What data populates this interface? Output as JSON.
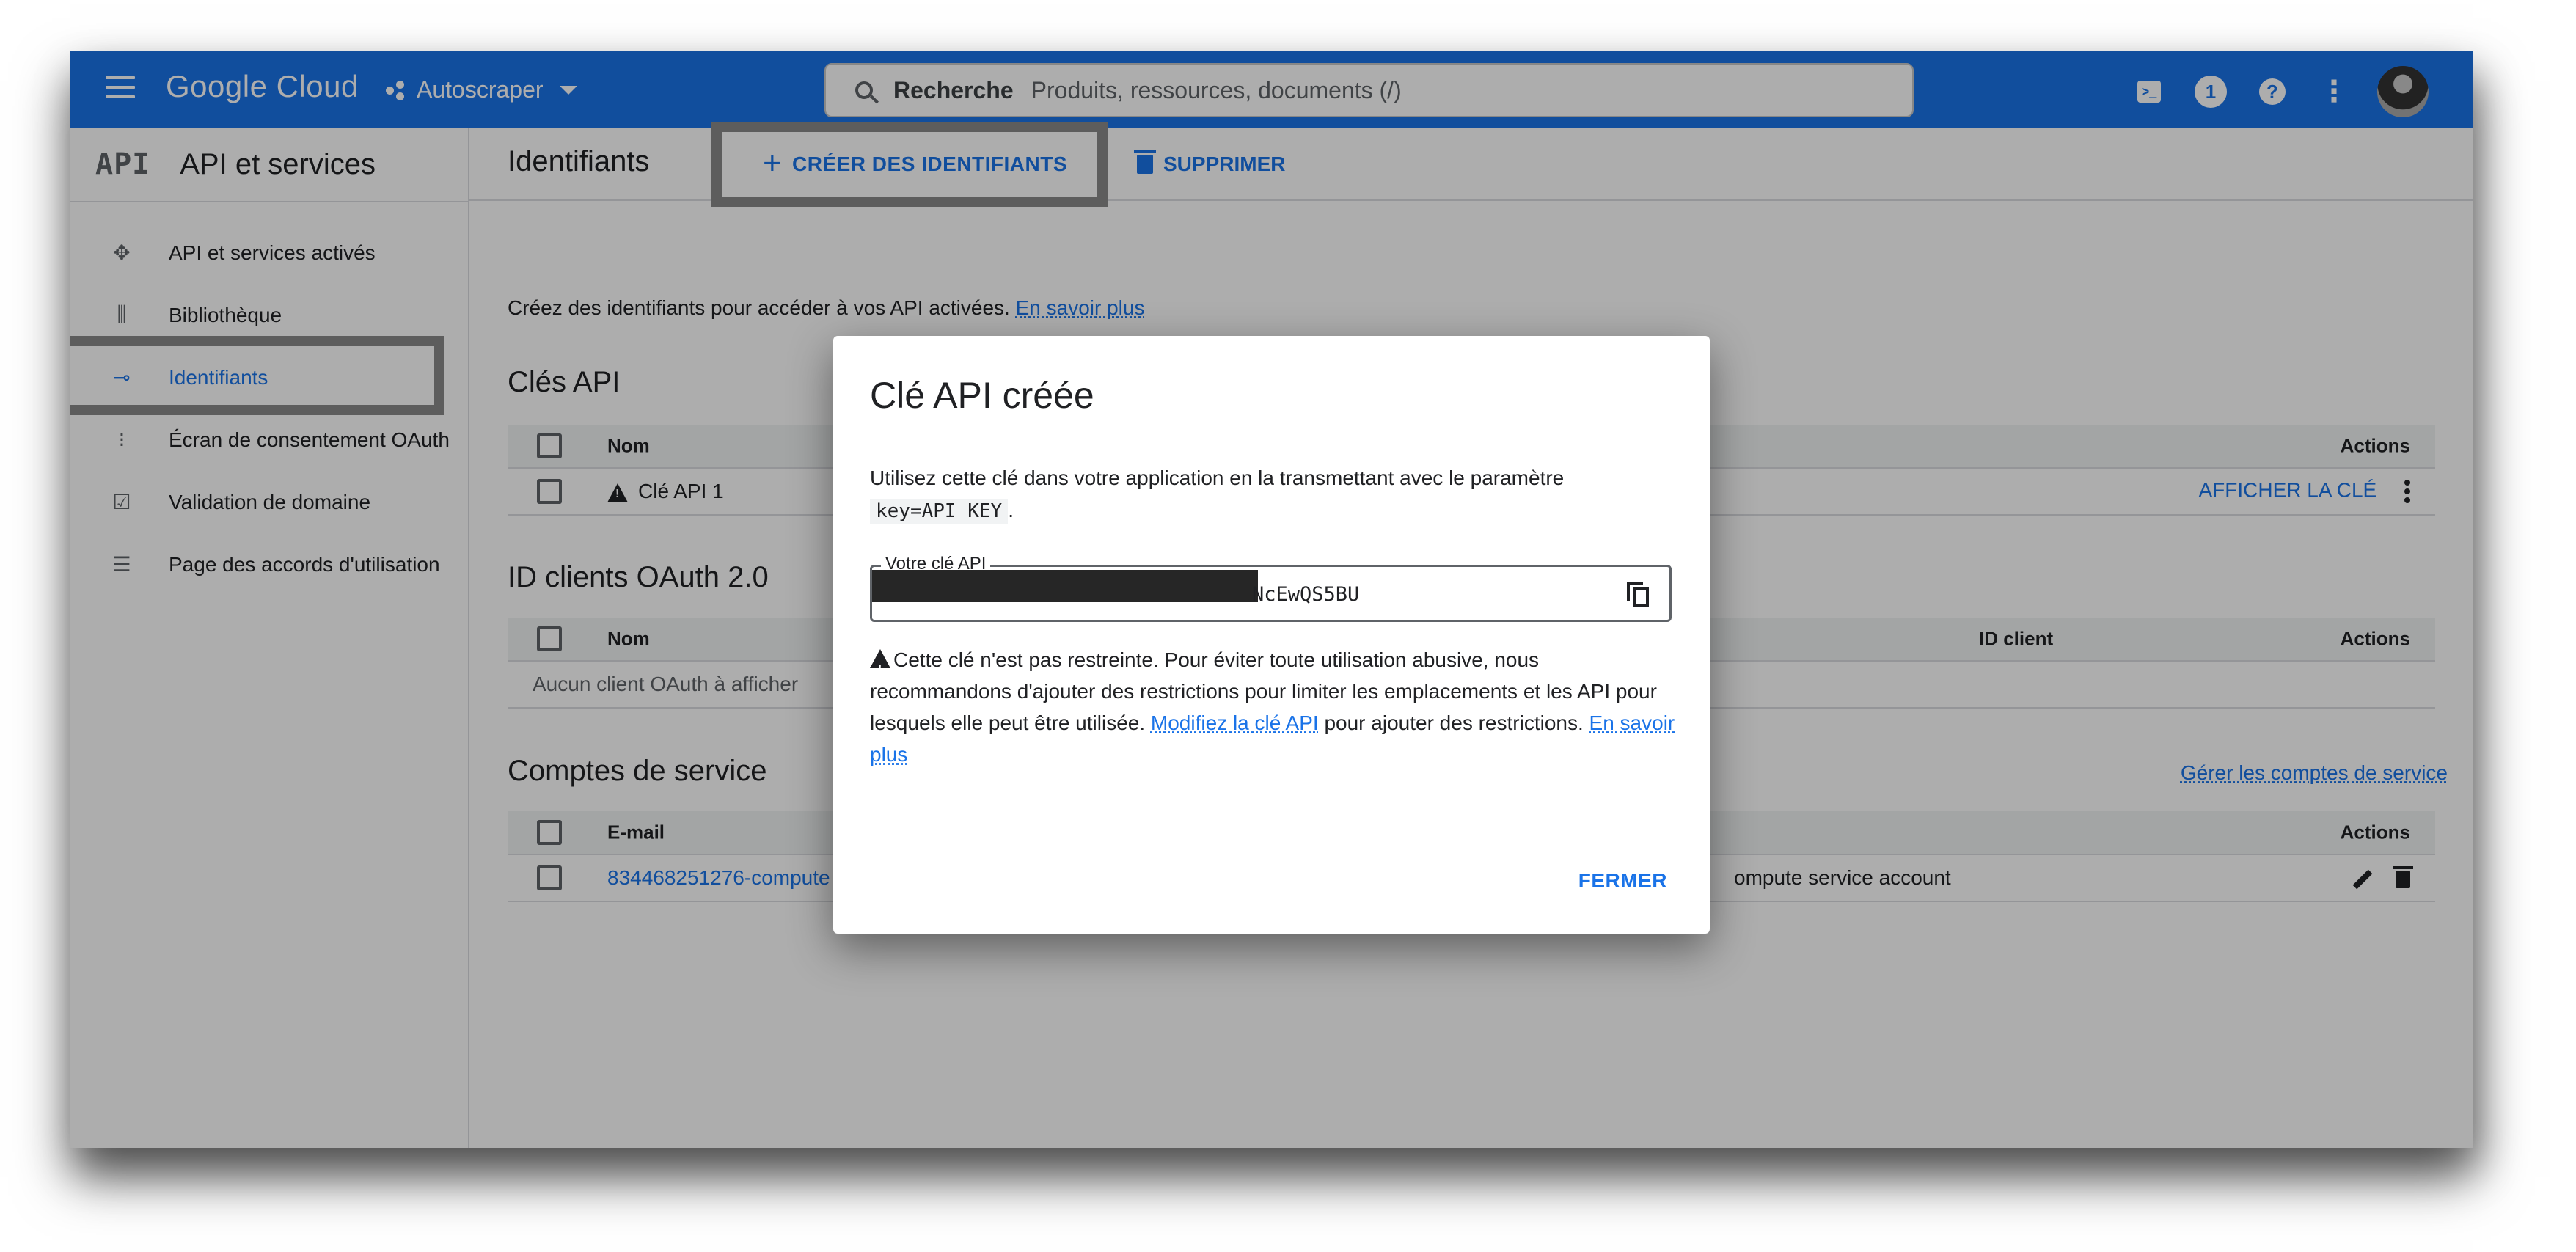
{
  "topbar": {
    "logo": "Google Cloud",
    "project": "Autoscraper",
    "search_label": "Recherche",
    "search_placeholder": "Produits, ressources, documents (/)",
    "notification_count": "1"
  },
  "sidebar": {
    "logo": "API",
    "title": "API et services",
    "items": [
      {
        "label": "API et services activés",
        "icon": "dashboard-icon"
      },
      {
        "label": "Bibliothèque",
        "icon": "library-icon"
      },
      {
        "label": "Identifiants",
        "icon": "key-icon",
        "active": true
      },
      {
        "label": "Écran de consentement OAuth",
        "icon": "consent-icon"
      },
      {
        "label": "Validation de domaine",
        "icon": "checkbox-icon"
      },
      {
        "label": "Page des accords d'utilisation",
        "icon": "settings-list-icon"
      }
    ]
  },
  "main": {
    "title": "Identifiants",
    "create_button": "CRÉER DES IDENTIFIANTS",
    "delete_button": "SUPPRIMER",
    "description": "Créez des identifiants pour accéder à vos API activées.",
    "learn_more": "En savoir plus",
    "api_keys": {
      "title": "Clés API",
      "headers": {
        "name": "Nom",
        "actions": "Actions"
      },
      "rows": [
        {
          "name": "Clé API 1",
          "action": "AFFICHER LA CLÉ"
        }
      ]
    },
    "oauth": {
      "title": "ID clients OAuth 2.0",
      "headers": {
        "name": "Nom",
        "client_id": "ID client",
        "actions": "Actions"
      },
      "empty": "Aucun client OAuth à afficher"
    },
    "service_accounts": {
      "title": "Comptes de service",
      "manage_link": "Gérer les comptes de service",
      "headers": {
        "email": "E-mail",
        "actions": "Actions"
      },
      "rows": [
        {
          "email": "834468251276-compute",
          "name": "ompute service account"
        }
      ]
    }
  },
  "dialog": {
    "title": "Clé API créée",
    "text": "Utilisez cette clé dans votre application en la transmettant avec le paramètre",
    "code": "key=API_KEY",
    "text_end": ".",
    "key_label": "Votre clé API",
    "key_value_visible": "NcEwQS5BU",
    "warning_1": "Cette clé n'est pas restreinte. Pour éviter toute utilisation abusive, nous recommandons d'ajouter des restrictions pour limiter les emplacements et les API pour lesquels elle peut être utilisée.",
    "warning_link": "Modifiez la clé API",
    "warning_2": "pour ajouter des restrictions.",
    "warning_more": "En savoir plus",
    "close_button": "FERMER"
  }
}
